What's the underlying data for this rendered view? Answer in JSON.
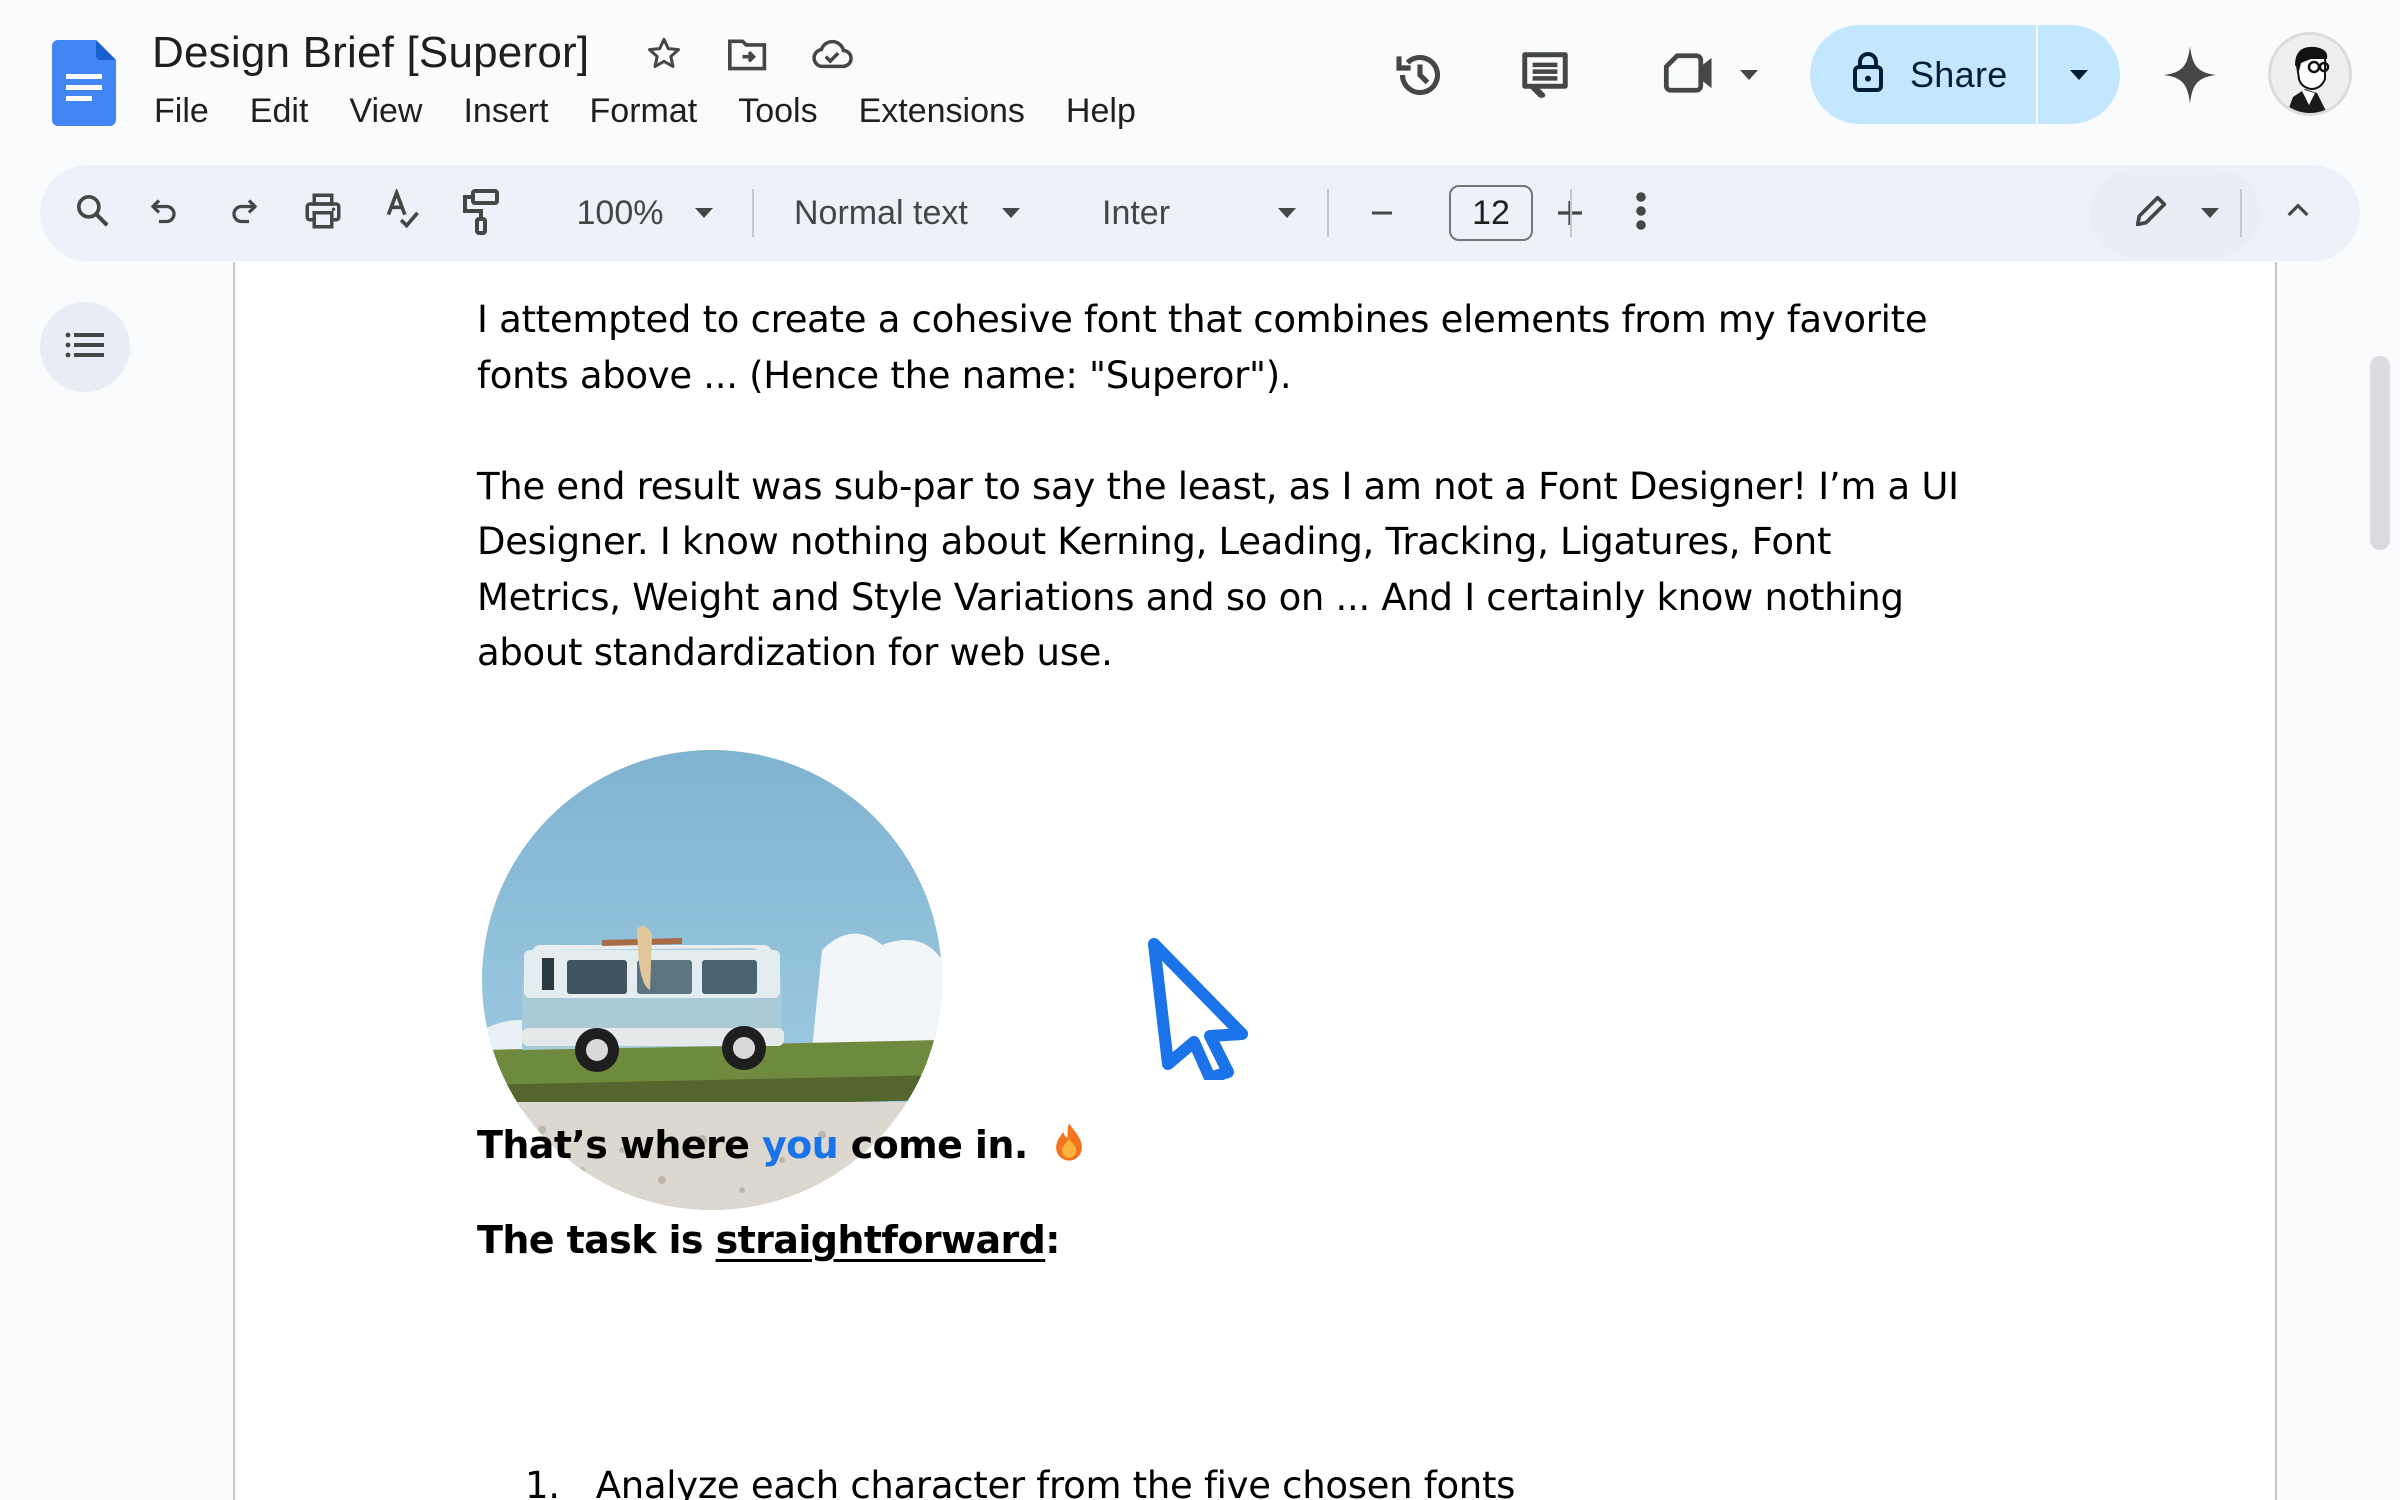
{
  "app": {
    "logo": "google-docs-icon",
    "title": "Design Brief [Superor]",
    "title_icons": [
      "star-icon",
      "move-to-folder-icon",
      "cloud-saved-icon"
    ]
  },
  "menu": [
    "File",
    "Edit",
    "View",
    "Insert",
    "Format",
    "Tools",
    "Extensions",
    "Help"
  ],
  "header_actions": {
    "history_icon": "version-history-icon",
    "comments_icon": "comments-icon",
    "meet_icon": "video-call-icon",
    "share_label": "Share",
    "share_icon": "lock-icon",
    "gemini_icon": "sparkle-icon",
    "avatar": "user-avatar"
  },
  "toolbar": {
    "icons": [
      "search-icon",
      "undo-icon",
      "redo-icon",
      "print-icon",
      "spellcheck-icon",
      "paint-format-icon"
    ],
    "zoom": "100%",
    "style": "Normal text",
    "font": "Inter",
    "font_size": "12",
    "decrease_label": "−",
    "increase_label": "+",
    "more_icon": "more-vert-icon",
    "mode_icon": "pencil-icon",
    "collapse_icon": "chevron-up-icon"
  },
  "sidebar": {
    "outline_icon": "document-outline-icon"
  },
  "document": {
    "paragraph1_lines": [
      "I attempted to create a cohesive font that combines elements from my favorite",
      "fonts above ...  (Hence the name: \"Superor\")."
    ],
    "paragraph2_lines": [
      "The end result was sub-par to say the least, as I am not a Font Designer! I’m a UI",
      "Designer. I know nothing about Kerning, Leading, Tracking, Ligatures, Font",
      "Metrics, Weight and Style Variations and so on ... And I certainly know nothing",
      "about standardization for web use."
    ],
    "image_alt": "Light blue camper van on grass with a person lying on the roof",
    "callout": {
      "before": "That’s where ",
      "highlight": "you",
      "after": " come in.",
      "emoji": "🔥"
    },
    "task": {
      "before": "The task is ",
      "underlined": "straightforward",
      "after": ":"
    },
    "list": [
      {
        "number": "1.",
        "text": "Analyze each character from the five chosen fonts"
      }
    ]
  },
  "colors": {
    "accent": "#1a73e8",
    "share_bg": "#c2e7ff",
    "toolbar_bg": "#edf2fa",
    "docs_blue": "#4285f4"
  }
}
